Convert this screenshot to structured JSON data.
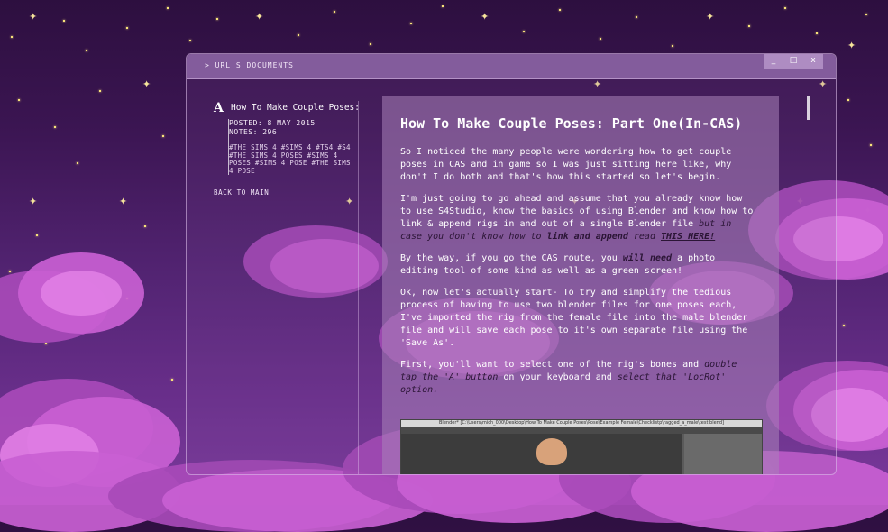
{
  "window": {
    "title": "> URL'S DOCUMENTS",
    "buttons": {
      "minimize": "_",
      "maximize": "□",
      "close": "x"
    }
  },
  "sidebar": {
    "blog_letter": "A",
    "blog_name": "How To Make Couple Poses:",
    "posted": "Posted: 8 May 2015",
    "notes": "Notes: 296",
    "tags": "#the sims 4 #sims 4 #ts4 #s4 #the sims 4 poses #sims 4 poses #sims 4 pose #the sims 4 pose",
    "back_link": "Back to main"
  },
  "post": {
    "title": "How To Make Couple Poses: Part One(In-CAS)",
    "p1": "So I noticed the many people were wondering how to get couple poses in CAS and in game so I was just sitting here like, why don't I do both and that's how this started so let's begin.",
    "p2_a": "I'm just going to go ahead and assume that you already know how to use S4Studio, know the basics of using Blender and know how to link & append rigs in and out of a single Blender file ",
    "p2_b": "but in case you don't know how to ",
    "p2_c": "link and append",
    "p2_d": " read ",
    "p2_e": "THIS HERE!",
    "p3_a": "By the way, if you go the CAS route, you ",
    "p3_b": "will need",
    "p3_c": " a photo editing tool of some kind as well as a green screen!",
    "p4": "Ok, now let's actually start- To try and simplify the tedious process of having to use two blender files for one poses each, I've imported the rig from the female file into the male blender file and will save each pose to it's own separate file using the 'Save As'.",
    "p5_a": "First, you'll want to select one of the rig's bones and ",
    "p5_b": "double tap the 'A' button",
    "p5_c": " on your keyboard and ",
    "p5_d": "select that 'LocRot' option.",
    "screenshot_title": "Blender* [C:\\Users\\mich_000\\Desktop\\How To Make Couple Poses\\Pose\\Example Female\\Checklistp\\ragged_a_male\\test.blend]"
  },
  "colors": {
    "sky_top": "#2d0f3f",
    "sky_bottom": "#7b3a9c",
    "cloud": "#c95fd3",
    "post_bg": "#aa82b9"
  }
}
